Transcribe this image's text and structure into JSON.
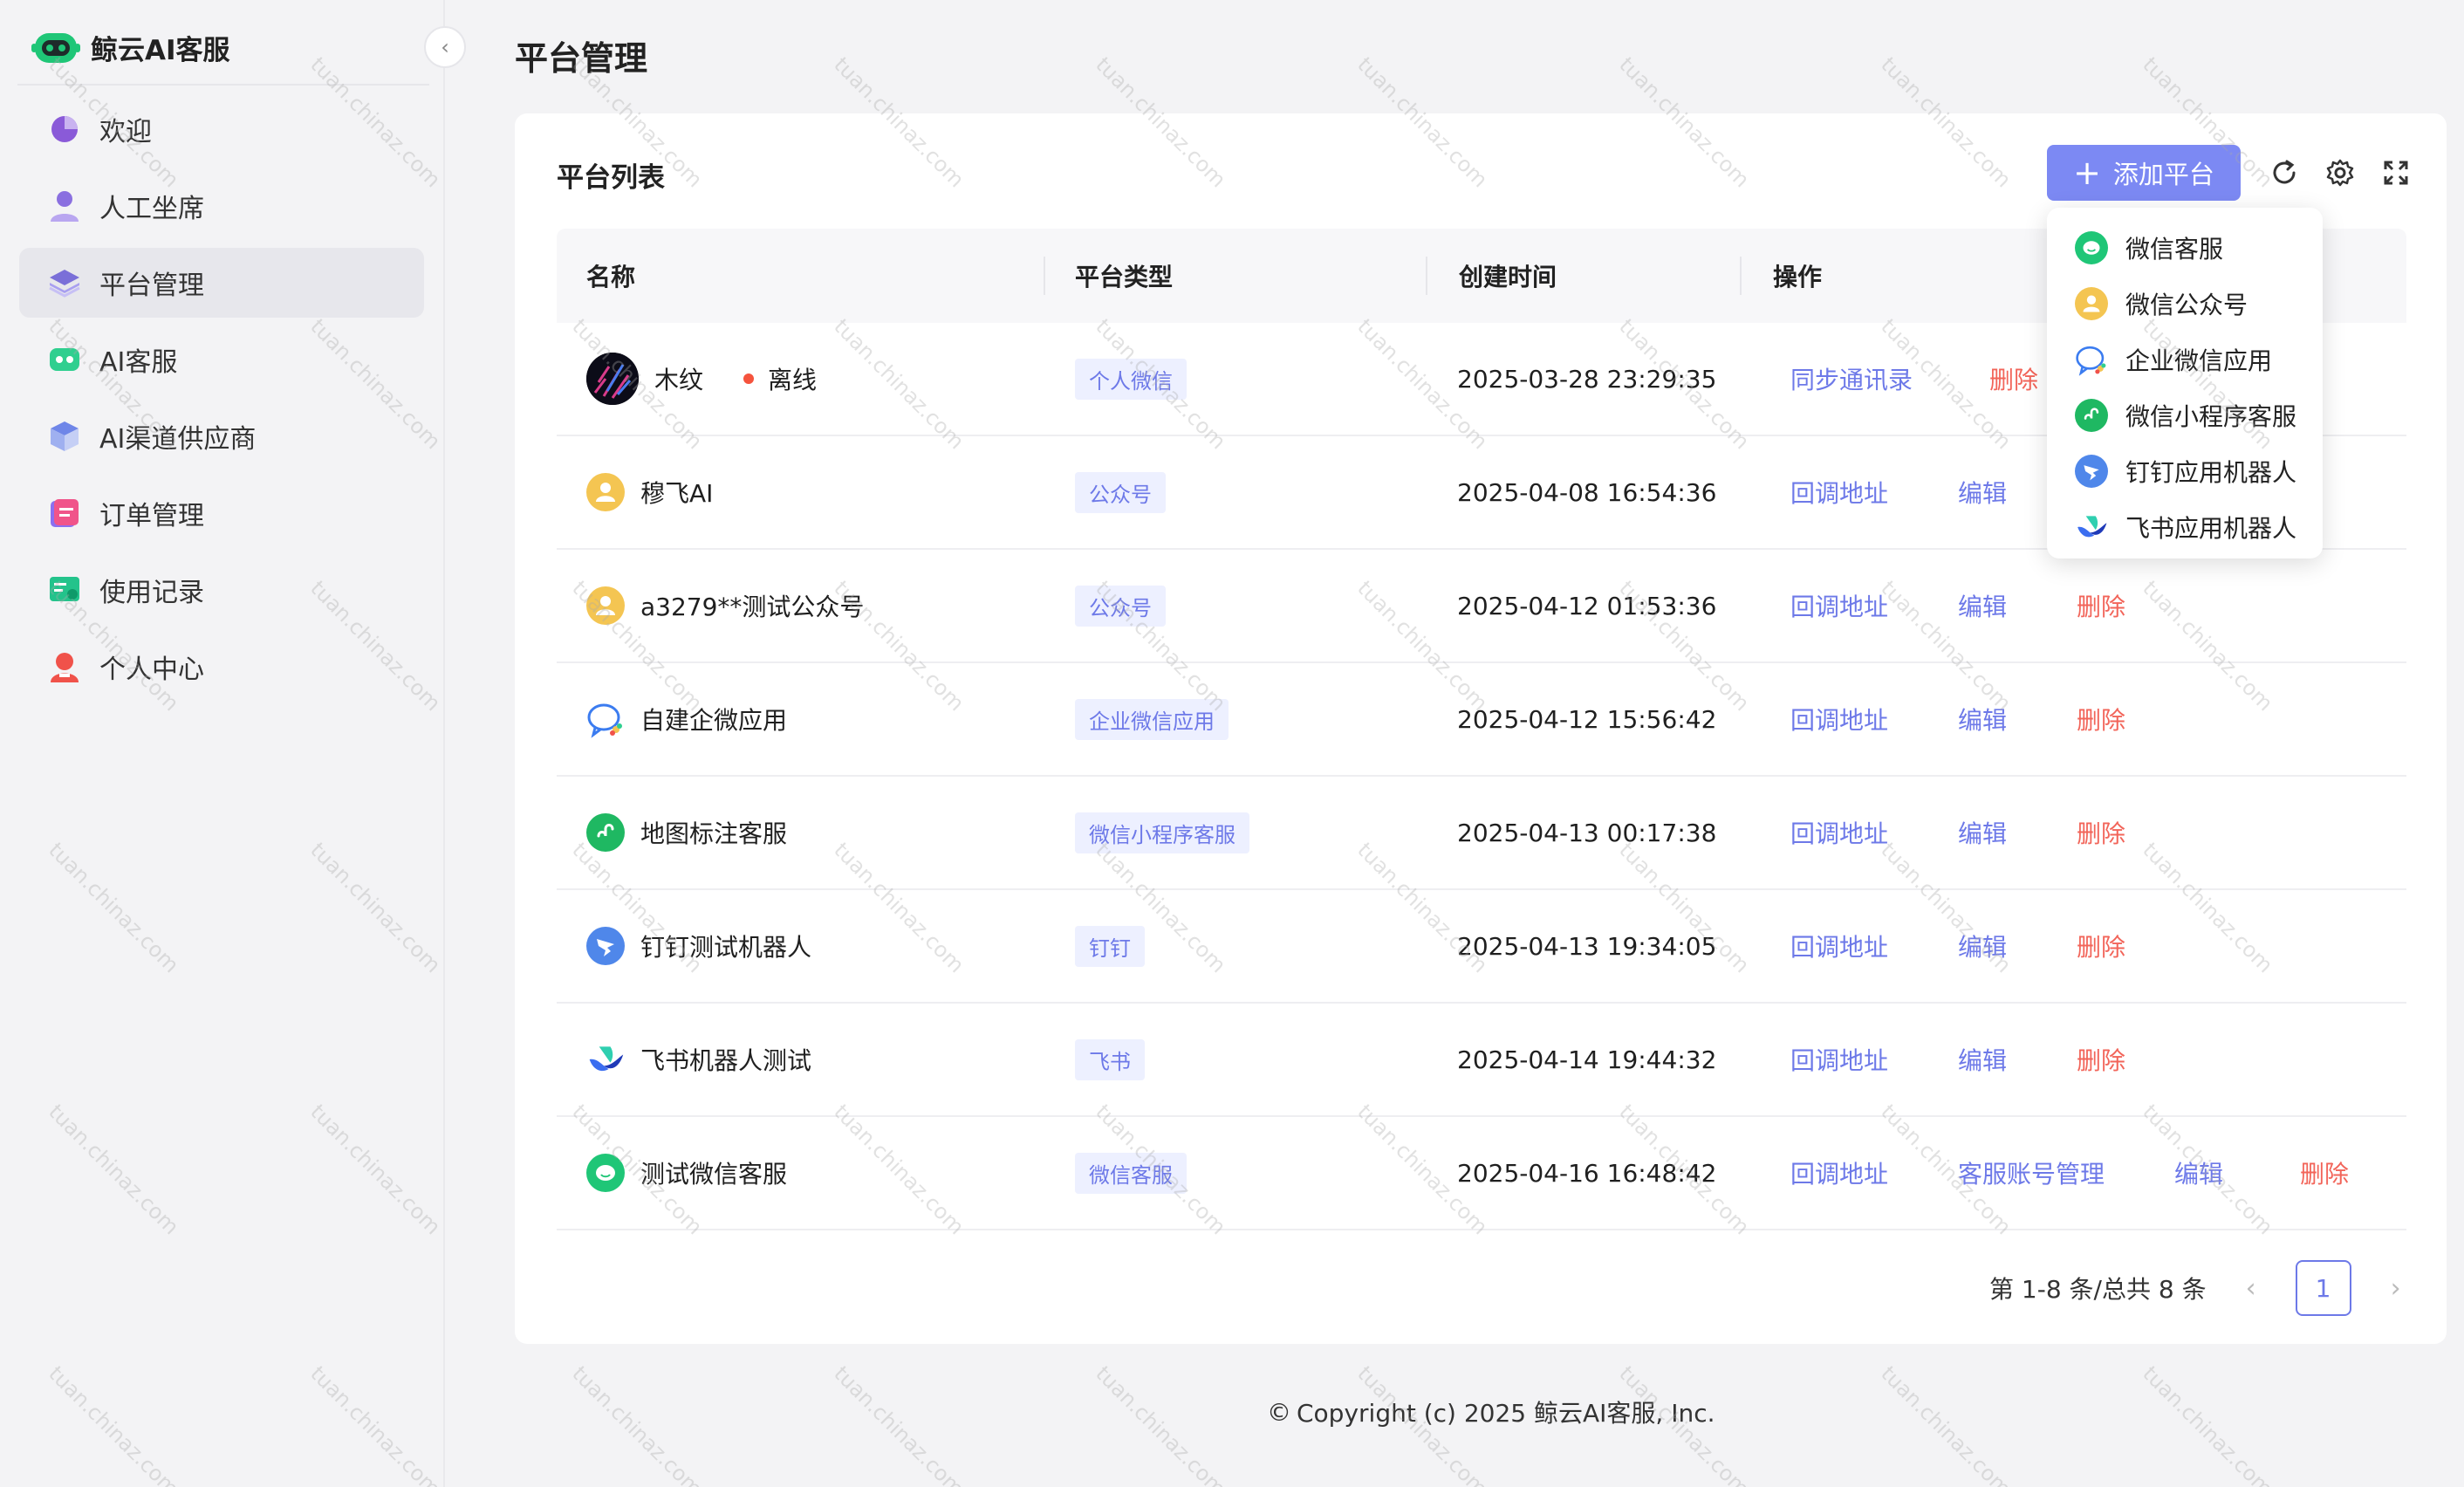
{
  "app": {
    "name": "鲸云AI客服"
  },
  "sidebar": {
    "items": [
      {
        "label": "欢迎",
        "icon": "pie-chart-icon",
        "color": "#8a5ad8"
      },
      {
        "label": "人工坐席",
        "icon": "user-icon",
        "color": "#8a6fe0"
      },
      {
        "label": "平台管理",
        "icon": "layers-icon",
        "color": "#7a6fd8",
        "active": true
      },
      {
        "label": "AI客服",
        "icon": "robot-icon",
        "color": "#2fcf8f"
      },
      {
        "label": "AI渠道供应商",
        "icon": "cube-icon",
        "color": "#6f86e8"
      },
      {
        "label": "订单管理",
        "icon": "order-icon",
        "color": "#e8548a"
      },
      {
        "label": "使用记录",
        "icon": "record-icon",
        "color": "#23c38b"
      },
      {
        "label": "个人中心",
        "icon": "person-icon",
        "color": "#f0524a"
      }
    ]
  },
  "page": {
    "title": "平台管理"
  },
  "card": {
    "title": "平台列表",
    "add_label": "添加平台"
  },
  "table": {
    "headers": [
      "名称",
      "平台类型",
      "创建时间",
      "操作"
    ],
    "rows": [
      {
        "name": "木纹",
        "status": "离线",
        "type": "个人微信",
        "created": "2025-03-28 23:29:35",
        "actions": [
          "同步通讯录",
          "删除"
        ],
        "icon": "avatar-photo"
      },
      {
        "name": "穆飞AI",
        "type": "公众号",
        "created": "2025-04-08 16:54:36",
        "actions": [
          "回调地址",
          "编辑"
        ],
        "icon": "wechat-official-icon"
      },
      {
        "name": "a3279**测试公众号",
        "type": "公众号",
        "created": "2025-04-12 01:53:36",
        "actions": [
          "回调地址",
          "编辑",
          "删除"
        ],
        "icon": "wechat-official-icon"
      },
      {
        "name": "自建企微应用",
        "type": "企业微信应用",
        "created": "2025-04-12 15:56:42",
        "actions": [
          "回调地址",
          "编辑",
          "删除"
        ],
        "icon": "wecom-icon"
      },
      {
        "name": "地图标注客服",
        "type": "微信小程序客服",
        "created": "2025-04-13 00:17:38",
        "actions": [
          "回调地址",
          "编辑",
          "删除"
        ],
        "icon": "mini-program-icon"
      },
      {
        "name": "钉钉测试机器人",
        "type": "钉钉",
        "created": "2025-04-13 19:34:05",
        "actions": [
          "回调地址",
          "编辑",
          "删除"
        ],
        "icon": "dingtalk-icon"
      },
      {
        "name": "飞书机器人测试",
        "type": "飞书",
        "created": "2025-04-14 19:44:32",
        "actions": [
          "回调地址",
          "编辑",
          "删除"
        ],
        "icon": "feishu-icon"
      },
      {
        "name": "测试微信客服",
        "type": "微信客服",
        "created": "2025-04-16 16:48:42",
        "actions": [
          "回调地址",
          "客服账号管理",
          "编辑",
          "删除"
        ],
        "icon": "wechat-service-icon"
      }
    ]
  },
  "pagination": {
    "summary": "第 1-8 条/总共 8 条",
    "current": "1"
  },
  "dropdown": {
    "items": [
      {
        "label": "微信客服",
        "icon": "wechat-service-icon"
      },
      {
        "label": "微信公众号",
        "icon": "wechat-official-icon"
      },
      {
        "label": "企业微信应用",
        "icon": "wecom-icon"
      },
      {
        "label": "微信小程序客服",
        "icon": "mini-program-icon"
      },
      {
        "label": "钉钉应用机器人",
        "icon": "dingtalk-icon"
      },
      {
        "label": "飞书应用机器人",
        "icon": "feishu-icon"
      }
    ]
  },
  "footer": {
    "text": "Copyright (c) 2025 鲸云AI客服, Inc."
  },
  "watermark": "tuan.chinaz.com",
  "colors": {
    "accent": "#7c89f3",
    "link": "#6d79e8",
    "danger": "#f2655a",
    "green": "#1fc677"
  }
}
